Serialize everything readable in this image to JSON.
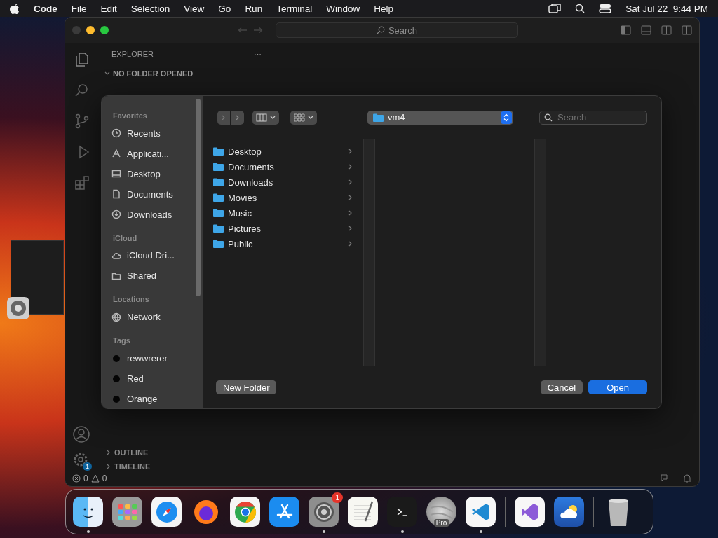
{
  "menu_bar": {
    "app": "Code",
    "items": [
      "File",
      "Edit",
      "Selection",
      "View",
      "Go",
      "Run",
      "Terminal",
      "Window",
      "Help"
    ],
    "clock": "Sat Jul 22  9:44 PM"
  },
  "editor": {
    "search": {
      "placeholder": "Search"
    },
    "explorer_title": "EXPLORER",
    "explorer_more": "···",
    "folder_section": "NO FOLDER OPENED",
    "panels": [
      {
        "label": "OUTLINE",
        "expanded": false
      },
      {
        "label": "TIMELINE",
        "expanded": false
      }
    ],
    "settings_badge": "1",
    "status_bar": {
      "errors": "0",
      "warnings": "0"
    }
  },
  "dialog": {
    "sidebar": [
      {
        "title": "Favorites",
        "items": [
          {
            "label": "Recents",
            "kind": "clock"
          },
          {
            "label": "Applicati...",
            "kind": "apps"
          },
          {
            "label": "Desktop",
            "kind": "desktop"
          },
          {
            "label": "Documents",
            "kind": "document"
          },
          {
            "label": "Downloads",
            "kind": "download"
          }
        ]
      },
      {
        "title": "iCloud",
        "items": [
          {
            "label": "iCloud Dri...",
            "kind": "cloud"
          },
          {
            "label": "Shared",
            "kind": "shared"
          }
        ]
      },
      {
        "title": "Locations",
        "items": [
          {
            "label": "Network",
            "kind": "globe"
          }
        ]
      },
      {
        "title": "Tags",
        "items": [
          {
            "label": "rewwrerer",
            "kind": "tag"
          },
          {
            "label": "Red",
            "kind": "tag"
          },
          {
            "label": "Orange",
            "kind": "tag"
          }
        ]
      }
    ],
    "location": "vm4",
    "search": {
      "placeholder": "Search"
    },
    "files": [
      {
        "name": "Desktop"
      },
      {
        "name": "Documents"
      },
      {
        "name": "Downloads"
      },
      {
        "name": "Movies"
      },
      {
        "name": "Music"
      },
      {
        "name": "Pictures"
      },
      {
        "name": "Public"
      }
    ],
    "buttons": [
      {
        "label": "New Folder",
        "kind": "secondary"
      },
      {
        "label": "Cancel",
        "kind": "secondary"
      },
      {
        "label": "Open",
        "kind": "primary"
      }
    ]
  },
  "dock": [
    {
      "kind": "finder",
      "running": true
    },
    {
      "kind": "launchpad",
      "running": false
    },
    {
      "kind": "safari",
      "running": false
    },
    {
      "kind": "firefox",
      "running": false
    },
    {
      "kind": "chrome",
      "running": false
    },
    {
      "kind": "appstore",
      "running": false
    },
    {
      "kind": "settings",
      "running": true,
      "badge": "1"
    },
    {
      "kind": "textedit",
      "running": false
    },
    {
      "kind": "terminal",
      "running": true
    },
    {
      "kind": "globe",
      "running": false,
      "label": "Pro"
    },
    {
      "kind": "vscode",
      "running": true
    },
    {
      "kind": "divider"
    },
    {
      "kind": "vs",
      "running": false
    },
    {
      "kind": "weather",
      "running": false
    },
    {
      "kind": "divider"
    },
    {
      "kind": "trash",
      "running": false
    }
  ]
}
